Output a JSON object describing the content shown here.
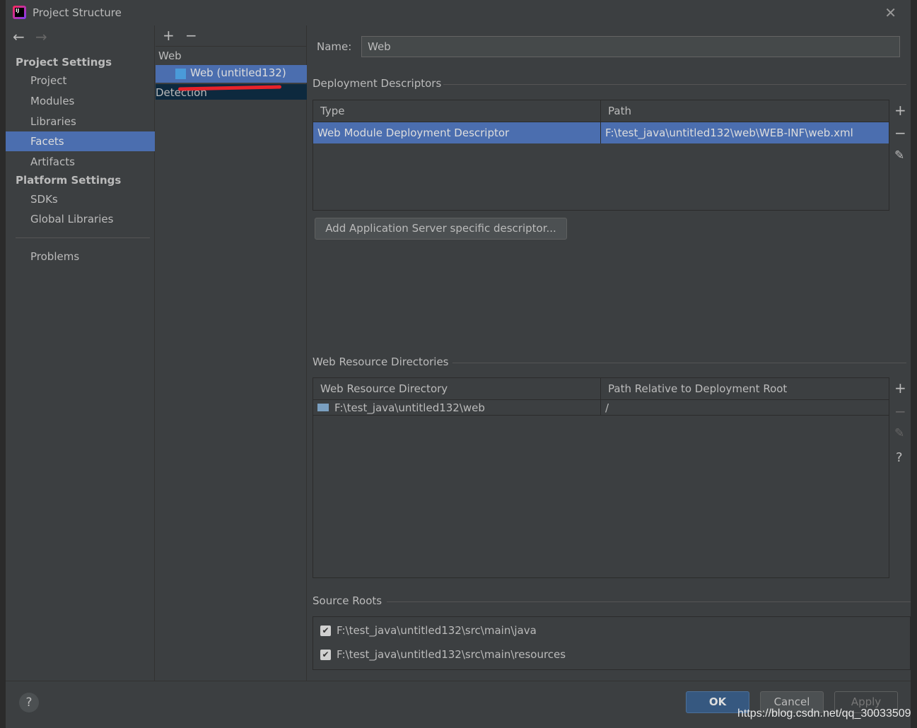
{
  "window": {
    "title": "Project Structure"
  },
  "nav": {
    "back": "←",
    "forward": "→"
  },
  "sidebar": {
    "project_settings": "Project Settings",
    "items": [
      "Project",
      "Modules",
      "Libraries",
      "Facets",
      "Artifacts"
    ],
    "platform_settings": "Platform Settings",
    "platform_items": [
      "SDKs",
      "Global Libraries"
    ],
    "problems": "Problems",
    "selected": "Facets"
  },
  "facets": {
    "add": "+",
    "remove": "−",
    "group": "Web",
    "item": "Web (untitled132)",
    "detection": "Detection"
  },
  "main": {
    "name_label": "Name:",
    "name_value": "Web",
    "deployment": {
      "title": "Deployment Descriptors",
      "columns": [
        "Type",
        "Path"
      ],
      "rows": [
        [
          "Web Module Deployment Descriptor",
          "F:\\test_java\\untitled132\\web\\WEB-INF\\web.xml"
        ]
      ],
      "add_button": "Add Application Server specific descriptor..."
    },
    "resources": {
      "title": "Web Resource Directories",
      "columns": [
        "Web Resource Directory",
        "Path Relative to Deployment Root"
      ],
      "rows": [
        [
          "F:\\test_java\\untitled132\\web",
          "/"
        ]
      ]
    },
    "source_roots": {
      "title": "Source Roots",
      "items": [
        {
          "path": "F:\\test_java\\untitled132\\src\\main\\java",
          "checked": true
        },
        {
          "path": "F:\\test_java\\untitled132\\src\\main\\resources",
          "checked": true
        }
      ]
    }
  },
  "buttons": {
    "ok": "OK",
    "cancel": "Cancel",
    "apply": "Apply",
    "help": "?"
  },
  "watermark": "https://blog.csdn.net/qq_30033509",
  "colors": {
    "selection": "#4b6eaf",
    "background": "#3c3f41",
    "annotation": "#e8222a"
  }
}
